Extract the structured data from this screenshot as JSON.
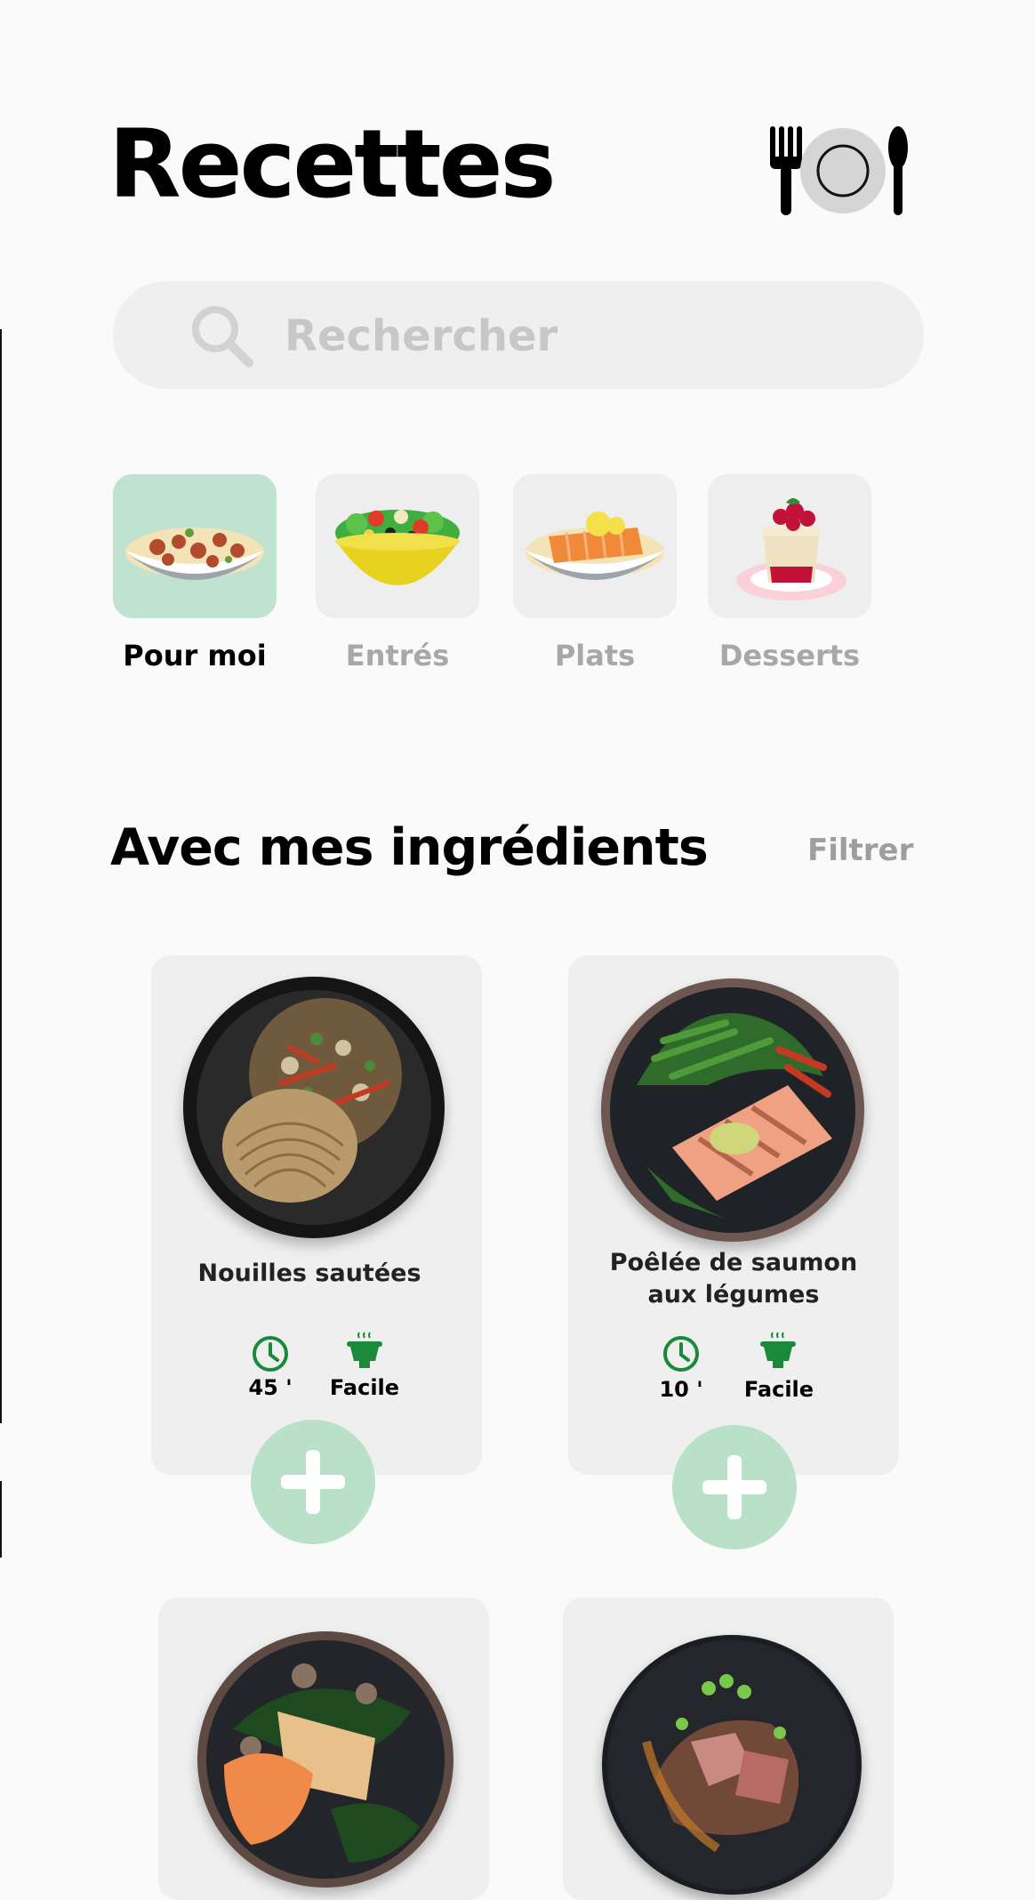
{
  "header": {
    "title": "Recettes",
    "logo_icon": "fork-plate-spoon-icon"
  },
  "search": {
    "placeholder": "Rechercher",
    "icon": "search-icon"
  },
  "categories": [
    {
      "label": "Pour moi",
      "icon": "pasta-bowl-icon",
      "selected": true
    },
    {
      "label": "Entrés",
      "icon": "salad-bowl-icon",
      "selected": false
    },
    {
      "label": "Plats",
      "icon": "salmon-dish-icon",
      "selected": false
    },
    {
      "label": "Desserts",
      "icon": "cake-icon",
      "selected": false
    }
  ],
  "section": {
    "title": "Avec mes ingrédients",
    "filter_label": "Filtrer"
  },
  "recipes": [
    {
      "title_line1": "Nouilles sautées",
      "title_line2": "",
      "time": "45 '",
      "difficulty": "Facile"
    },
    {
      "title_line1": "Poêlée de saumon",
      "title_line2": "aux légumes",
      "time": "10 '",
      "difficulty": "Facile"
    },
    {
      "title_line1": "",
      "title_line2": "",
      "time": "",
      "difficulty": ""
    },
    {
      "title_line1": "",
      "title_line2": "",
      "time": "",
      "difficulty": ""
    }
  ],
  "colors": {
    "accent_green": "#1a8a3a",
    "selected_category_bg": "#bfe3cf",
    "add_button_bg": "#b9e1c8"
  }
}
